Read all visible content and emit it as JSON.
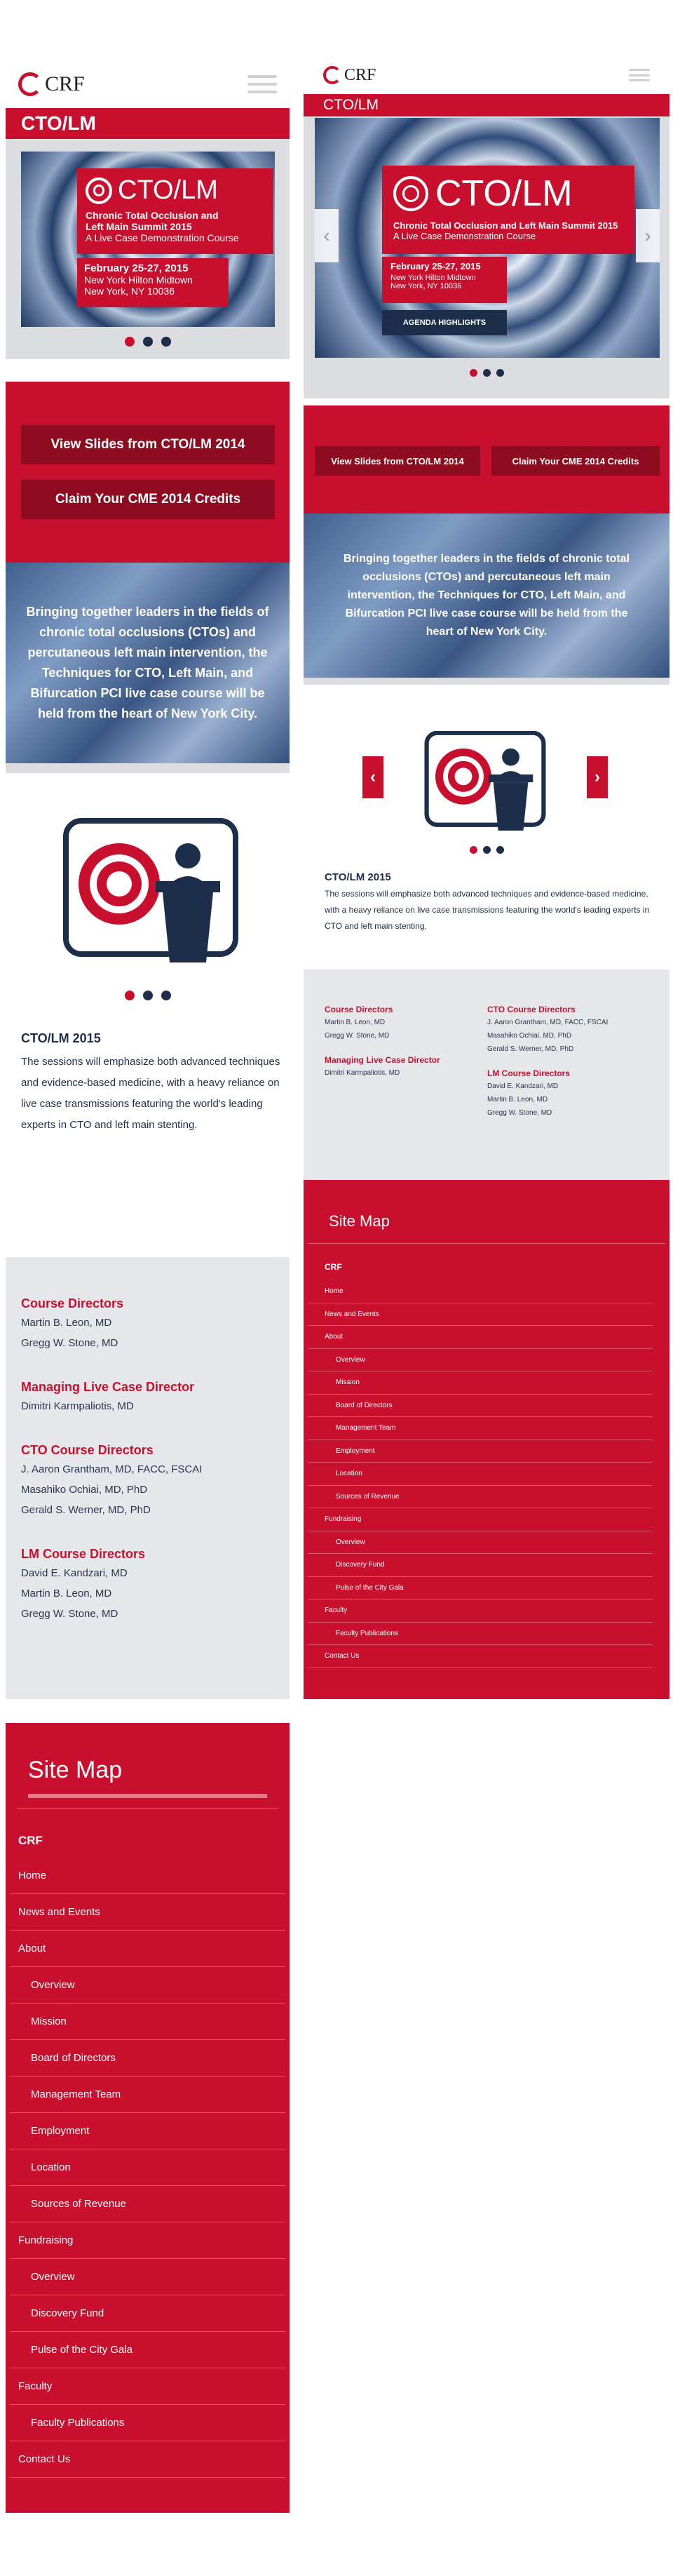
{
  "brand": {
    "logo_text": "CRF",
    "accent": "#c8102e",
    "navy": "#1c2e4a"
  },
  "page_title": "CTO/LM",
  "hero": {
    "badge_title": "CTO/LM",
    "summit_line1": "Chronic Total Occlusion and",
    "summit_line2": "Left Main Summit 2015",
    "summit_full": "Chronic Total Occlusion and Left Main Summit 2015",
    "subtitle": "A Live Case Demonstration Course",
    "dates": "February 25-27, 2015",
    "venue": "New York Hilton Midtown",
    "city": "New York, NY 10036",
    "agenda_label": "AGENDA HIGHLIGHTS"
  },
  "buttons": {
    "view_slides": "View Slides from CTO/LM 2014",
    "claim_cme": "Claim Your CME 2014 Credits"
  },
  "intro_text": "Bringing together leaders in the fields of chronic total occlusions (CTOs) and percutaneous left main intervention, the Techniques for CTO, Left Main, and Bifurcation PCI live case course will be held from the heart of New York City.",
  "intro_text_short": "Bringing together leaders in the fields of chronic total occlusions (CTOs) and percutaneous left main intervention, the Techniques for CTO, Left Main, and Bifurcation PCI live case course will be held from the heart of New York City.",
  "about": {
    "heading": "CTO/LM 2015",
    "body": "The sessions will emphasize both advanced techniques and evidence-based medicine, with a heavy reliance on live case transmissions featuring the world's leading experts in CTO and left main stenting."
  },
  "directors": [
    {
      "title": "Course Directors",
      "names": [
        "Martin B. Leon, MD",
        "Gregg W. Stone, MD"
      ]
    },
    {
      "title": "Managing Live Case Director",
      "names": [
        "Dimitri Karmpaliotis, MD"
      ]
    },
    {
      "title": "CTO Course Directors",
      "names": [
        "J. Aaron Grantham, MD, FACC, FSCAI",
        "Masahiko Ochiai, MD, PhD",
        "Gerald S. Werner, MD, PhD"
      ]
    },
    {
      "title": "LM Course Directors",
      "names": [
        "David E. Kandzari, MD",
        "Martin B. Leon, MD",
        "Gregg W. Stone, MD"
      ]
    }
  ],
  "sitemap": {
    "title": "Site Map",
    "root": "CRF",
    "items": [
      {
        "label": "Home",
        "level": 0
      },
      {
        "label": "News and Events",
        "level": 0
      },
      {
        "label": "About",
        "level": 0
      },
      {
        "label": "Overview",
        "level": 1
      },
      {
        "label": "Mission",
        "level": 1
      },
      {
        "label": "Board of Directors",
        "level": 1
      },
      {
        "label": "Management Team",
        "level": 1
      },
      {
        "label": "Employment",
        "level": 1
      },
      {
        "label": "Location",
        "level": 1
      },
      {
        "label": "Sources of Revenue",
        "level": 1
      },
      {
        "label": "Fundraising",
        "level": 0
      },
      {
        "label": "Overview",
        "level": 1
      },
      {
        "label": "Discovery Fund",
        "level": 1
      },
      {
        "label": "Pulse of the City Gala",
        "level": 1
      },
      {
        "label": "Faculty",
        "level": 0
      },
      {
        "label": "Faculty Publications",
        "level": 1
      },
      {
        "label": "Contact Us",
        "level": 0
      }
    ]
  },
  "carousel": {
    "slides": 3,
    "active": 0
  },
  "icons": {
    "menu": "hamburger-icon",
    "prev": "chevron-left-icon",
    "next": "chevron-right-icon"
  }
}
